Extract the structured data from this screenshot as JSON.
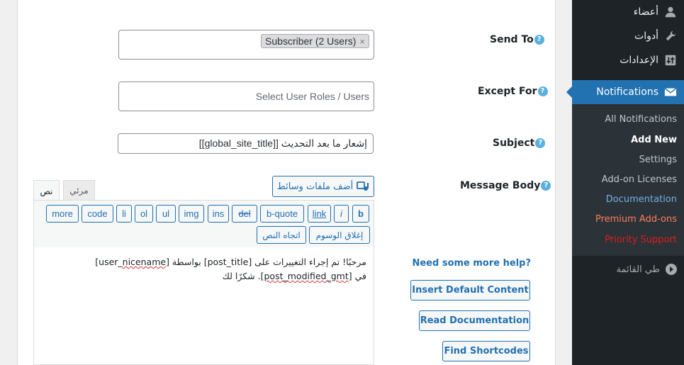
{
  "sidebar": {
    "items": [
      {
        "label": "أعضاء",
        "icon": "users-icon"
      },
      {
        "label": "أدوات",
        "icon": "wrench-icon"
      },
      {
        "label": "الإعدادات",
        "icon": "settings-icon"
      },
      {
        "label": "Notifications",
        "icon": "envelope-icon"
      }
    ],
    "submenu": [
      "All Notifications",
      "Add New",
      "Settings",
      "Add-on Licenses",
      "Documentation",
      "Premium Add-ons",
      "Priority Support"
    ],
    "collapse_label": "طي القائمة"
  },
  "form": {
    "send_to": {
      "label": "Send To",
      "tag": "Subscriber (2 Users)",
      "tag_remove": "×"
    },
    "except_for": {
      "label": "Except For",
      "placeholder": "Select User Roles / Users"
    },
    "subject": {
      "label": "Subject",
      "value": "إشعار ما بعد التحديث [[global_site_title]]"
    },
    "message_body": {
      "label": "Message Body"
    },
    "help_glyph": "?"
  },
  "editor": {
    "add_media": "أضف ملفات وسائط",
    "tabs": {
      "visual": "مرئي",
      "text": "نص"
    },
    "quicktags": [
      "b",
      "i",
      "link",
      "b-quote",
      "del",
      "ins",
      "img",
      "ul",
      "ol",
      "li",
      "code",
      "more",
      "إغلاق الوسوم",
      "اتجاه النص"
    ],
    "content": {
      "line1_a": "مرحبًا! تم إجراء التغييرات على [post_title] بواسطة [user_",
      "line1_b": "nicename",
      "line1_c": "]",
      "line2_a": "في [",
      "line2_b": "post_modified_gmt",
      "line2_c": "]. شكرًا لك"
    }
  },
  "help": {
    "title": "Need some more help?",
    "buttons": [
      "Insert Default Content",
      "Read Documentation",
      "Find Shortcodes"
    ]
  },
  "colors": {
    "accent": "#2271b1",
    "sidebar": "#1d2327",
    "help_icon": "#5ab0e0"
  }
}
